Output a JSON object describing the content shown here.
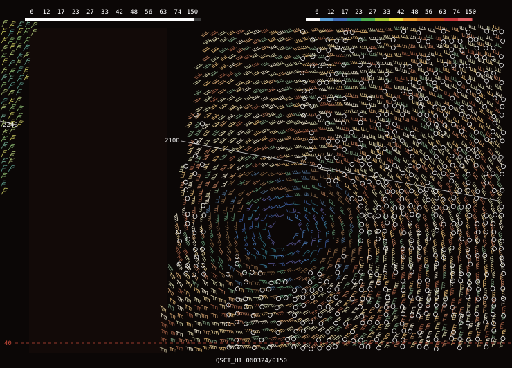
{
  "left_scale": {
    "ticks": [
      "6",
      "12",
      "17",
      "23",
      "27",
      "33",
      "42",
      "48",
      "56",
      "63",
      "74",
      "150"
    ]
  },
  "right_scale": {
    "ticks": [
      "6",
      "12",
      "17",
      "23",
      "27",
      "33",
      "42",
      "48",
      "56",
      "63",
      "74",
      "150"
    ],
    "colors": [
      "#ffffff",
      "#5aa0d8",
      "#3f6fb8",
      "#2e8a8a",
      "#4caf50",
      "#a6c832",
      "#f0e040",
      "#f0a030",
      "#d87a2a",
      "#c8501e",
      "#c83a3a",
      "#e06060"
    ]
  },
  "orbit_labels": {
    "left_time": "2240",
    "center_time": "2100"
  },
  "latitude_label": "40",
  "product_label": "QSCT_HI 060324/0150",
  "colors": {
    "background": "#0b0706",
    "orbit_track": "#f0f0f0",
    "latitude_line": "#c84a3a"
  }
}
